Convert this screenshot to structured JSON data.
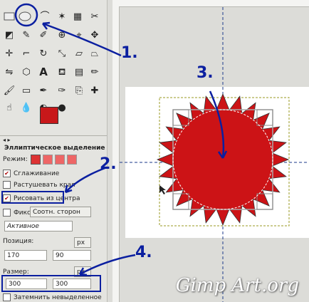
{
  "options": {
    "title": "Эллиптическое выделение",
    "mode_label": "Режим:",
    "antialias_label": "Сглаживание",
    "feather_label": "Растушевать края",
    "from_center_label": "Рисовать из центра",
    "fixed_label": "Фикс.:",
    "fixed_value": "Соотн. сторон",
    "active_value": "Активное",
    "position_label": "Позиция:",
    "position_x": "170",
    "position_y": "90",
    "position_unit": "px",
    "size_label": "Размер:",
    "size_w": "300",
    "size_h": "300",
    "size_unit": "px",
    "highlight_label": "Затемнить невыделенное"
  },
  "annotations": {
    "step1": "1.",
    "step2": "2.",
    "step3": "3.",
    "step4": "4.",
    "color": "#0b1fa0"
  },
  "watermark": "Gimp Art.org",
  "colors": {
    "foreground": "#c8181a",
    "background": "#000000",
    "star": "#cc1316"
  }
}
